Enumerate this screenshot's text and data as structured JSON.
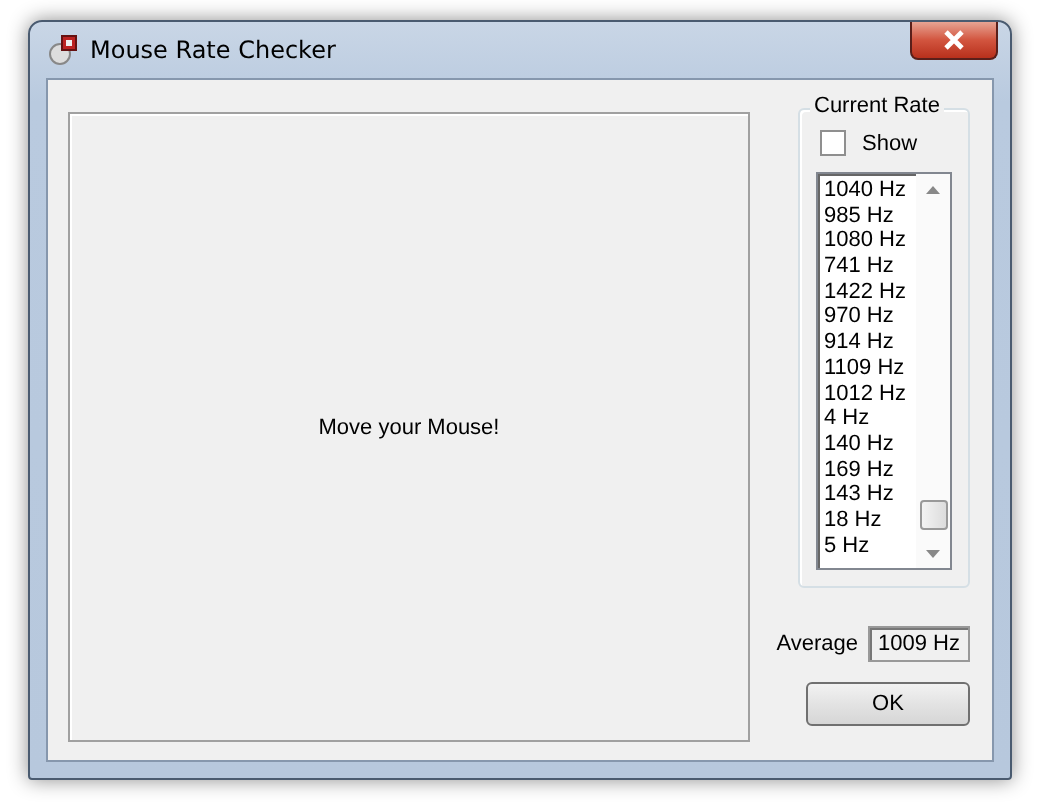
{
  "window": {
    "title": "Mouse Rate Checker"
  },
  "canvas": {
    "message": "Move your Mouse!"
  },
  "current_rate": {
    "title": "Current Rate",
    "show": {
      "label": "Show",
      "checked": false
    },
    "rates": [
      "1040 Hz",
      "985 Hz",
      "1080 Hz",
      "741 Hz",
      "1422 Hz",
      "970 Hz",
      "914 Hz",
      "1109 Hz",
      "1012 Hz",
      "4 Hz",
      "140 Hz",
      "169 Hz",
      "143 Hz",
      "18 Hz",
      "5 Hz"
    ]
  },
  "average": {
    "label": "Average",
    "value": "1009 Hz"
  },
  "buttons": [
    "OK"
  ]
}
